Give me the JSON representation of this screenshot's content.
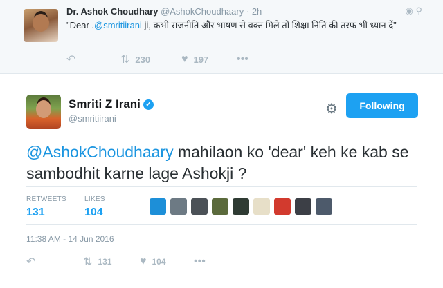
{
  "reply": {
    "name": "Dr. Ashok Choudhary",
    "handle": "@AshokChoudhaary",
    "dot": "·",
    "time": "2h",
    "text_prefix": "\"Dear .",
    "mention": "@smritiirani",
    "text_suffix": " ji, कभी राजनीति और भाषण से वक्त मिले तो शिक्षा निति की तरफ भी ध्यान दें\"",
    "retweets": "230",
    "likes": "197",
    "icons": {
      "reply": "reply-icon",
      "retweet": "retweet-icon",
      "like": "heart-icon",
      "more": "more-icon",
      "globe": "globe-icon",
      "location": "location-icon"
    }
  },
  "tweet": {
    "name": "Smriti Z Irani",
    "handle": "@smritiirani",
    "follow_label": "Following",
    "mention": "@AshokChoudhaary",
    "text": " mahilaon ko 'dear' keh ke kab se sambodhit karne lage Ashokji ?",
    "stats": {
      "retweets_label": "RETWEETS",
      "retweets": "131",
      "likes_label": "LIKES",
      "likes": "104"
    },
    "date": "11:38 AM - 14 Jun 2016",
    "actions": {
      "retweets": "131",
      "likes": "104"
    },
    "liker_colors": [
      "#1d8fd8",
      "#6d7a84",
      "#4b5157",
      "#5b6a3c",
      "#2f3b33",
      "#e7dfc8",
      "#d23a2e",
      "#3c3f46",
      "#4d5a6b"
    ]
  },
  "colors": {
    "accent": "#1da1f2",
    "mention": "#1b95e0",
    "muted": "#8899a6"
  }
}
